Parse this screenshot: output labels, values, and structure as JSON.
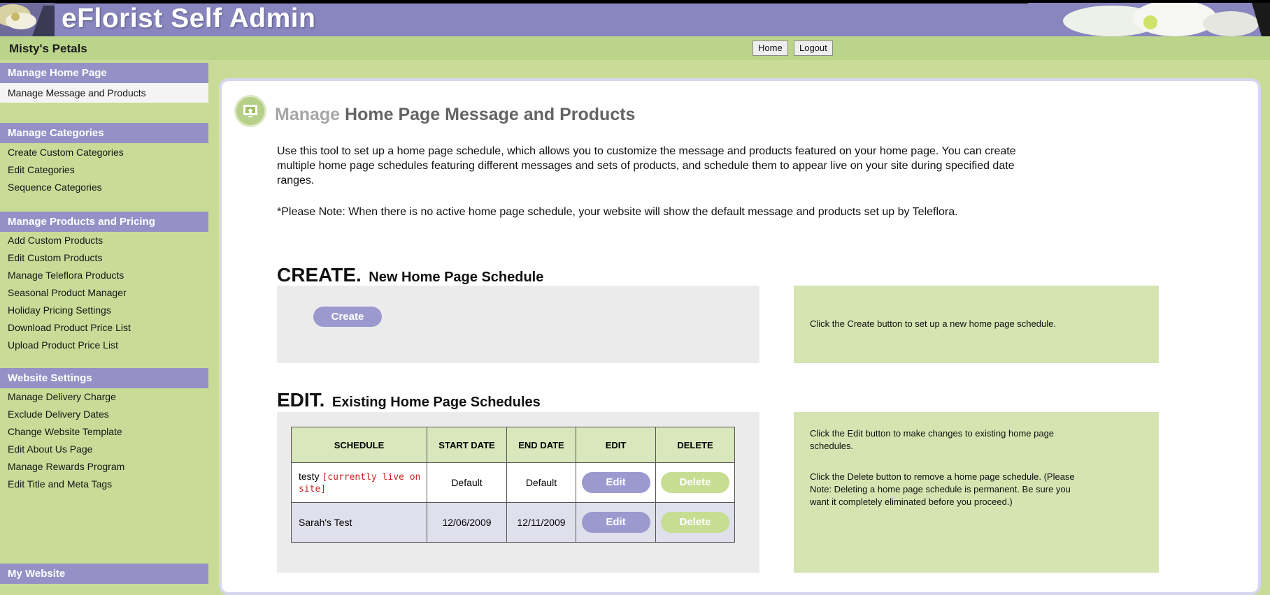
{
  "app": {
    "title": "eFlorist Self Admin"
  },
  "store": {
    "name": "Misty's Petals"
  },
  "topnav": {
    "home": "Home",
    "logout": "Logout"
  },
  "sidebar": {
    "sections": [
      {
        "heading": "Manage Home Page",
        "items": [
          "Manage Message and Products"
        ]
      },
      {
        "heading": "Manage Categories",
        "items": [
          "Create Custom Categories",
          "Edit Categories",
          "Sequence Categories"
        ]
      },
      {
        "heading": "Manage Products and Pricing",
        "items": [
          "Add Custom Products",
          "Edit Custom Products",
          "Manage Teleflora Products",
          "Seasonal Product Manager",
          "Holiday Pricing Settings",
          "Download Product Price List",
          "Upload Product Price List"
        ]
      },
      {
        "heading": "Website Settings",
        "items": [
          "Manage Delivery Charge",
          "Exclude Delivery Dates",
          "Change Website Template",
          "Edit About Us Page",
          "Manage Rewards Program",
          "Edit Title and Meta Tags"
        ]
      },
      {
        "heading": "My Website",
        "items": []
      }
    ]
  },
  "main": {
    "title_prefix": "Manage",
    "title_rest": "Home Page Message and Products",
    "intro": "Use this tool to set up a home page schedule, which allows you to customize the message and products featured on your home page. You can create multiple home page schedules featuring different messages and sets of products, and schedule them to appear live on your site during specified date ranges.",
    "note": "*Please Note: When there is no active home page schedule, your website will show the default message and products set up by Teleflora.",
    "create": {
      "heading_big": "CREATE.",
      "heading_small": "New Home Page Schedule",
      "button": "Create",
      "info": "Click the Create button to set up a new home page schedule."
    },
    "edit": {
      "heading_big": "EDIT.",
      "heading_small": "Existing Home Page Schedules",
      "info1": "Click the Edit button to make changes to existing home page schedules.",
      "info2": "Click the Delete button to remove a home page schedule. (Please Note: Deleting a home page schedule is permanent. Be sure you want it completely eliminated before you proceed.)",
      "columns": [
        "SCHEDULE",
        "START DATE",
        "END DATE",
        "EDIT",
        "DELETE"
      ],
      "rows": [
        {
          "name": "testy",
          "badge": "[currently live on site]",
          "start": "Default",
          "end": "Default",
          "edit": "Edit",
          "delete": "Delete"
        },
        {
          "name": "Sarah's Test",
          "badge": "",
          "start": "12/06/2009",
          "end": "12/11/2009",
          "edit": "Edit",
          "delete": "Delete"
        }
      ]
    }
  }
}
